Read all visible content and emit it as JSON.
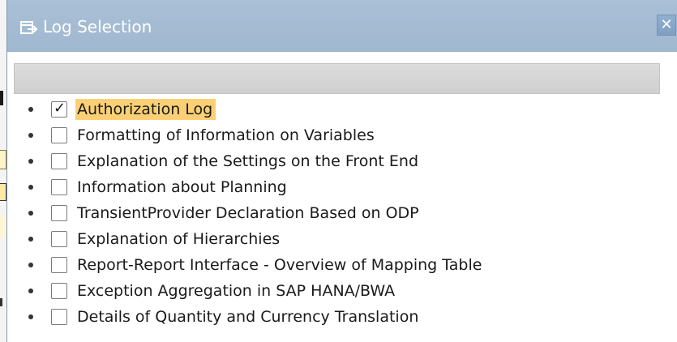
{
  "dialog": {
    "title": "Log Selection",
    "close_glyph": "✕",
    "title_icon": "window-icon",
    "close_icon": "close-icon"
  },
  "options": [
    {
      "label": "Authorization Log",
      "checked": true
    },
    {
      "label": "Formatting of Information on Variables",
      "checked": false
    },
    {
      "label": "Explanation of the Settings on the Front End",
      "checked": false
    },
    {
      "label": "Information about Planning",
      "checked": false
    },
    {
      "label": "TransientProvider Declaration Based on ODP",
      "checked": false
    },
    {
      "label": "Explanation of Hierarchies",
      "checked": false
    },
    {
      "label": "Report-Report Interface - Overview of Mapping Table",
      "checked": false
    },
    {
      "label": "Exception Aggregation in SAP HANA/BWA",
      "checked": false
    },
    {
      "label": "Details of Quantity and Currency Translation",
      "checked": false
    }
  ],
  "colors": {
    "titlebar": "#a3bad2",
    "selected_highlight": "#fbd075",
    "toolbar_band": "#d5d5d5"
  }
}
